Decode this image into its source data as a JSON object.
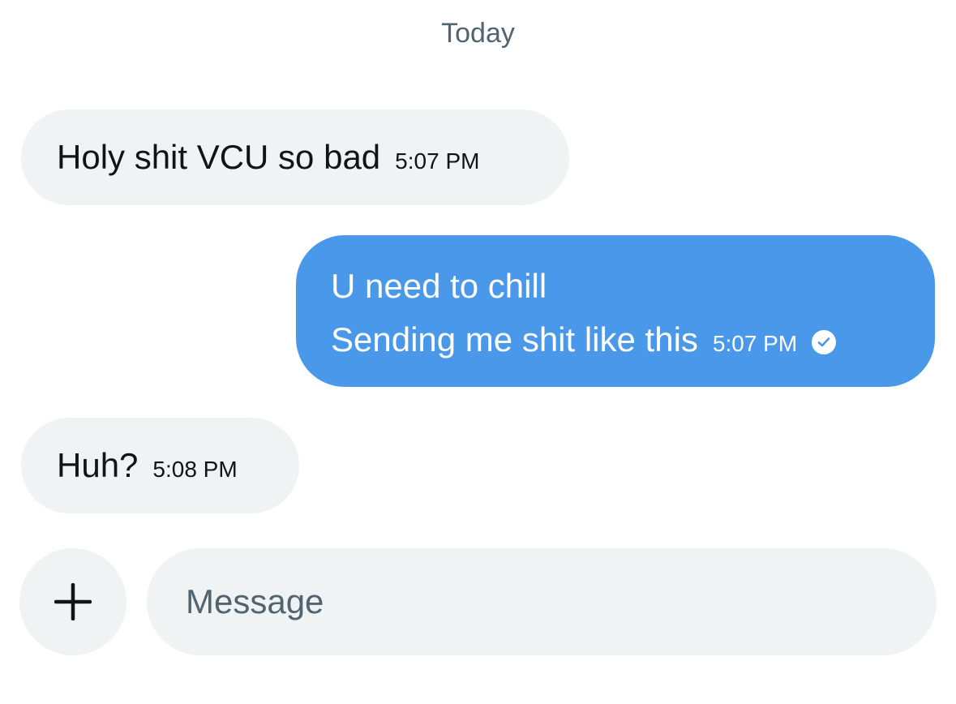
{
  "conversation": {
    "date_divider": "Today",
    "messages": [
      {
        "direction": "received",
        "lines": [
          "Holy shit VCU so bad"
        ],
        "time": "5:07 PM"
      },
      {
        "direction": "sent",
        "lines": [
          "U need to chill",
          "Sending me shit like this"
        ],
        "time": "5:07 PM",
        "status_icon": "read-check-icon"
      },
      {
        "direction": "received",
        "lines": [
          "Huh?"
        ],
        "time": "5:08 PM"
      }
    ]
  },
  "composer": {
    "add_icon": "plus-icon",
    "placeholder": "Message",
    "value": ""
  },
  "colors": {
    "received_bubble": "#eff3f4",
    "sent_bubble": "#4a98e9",
    "secondary_text": "#536471"
  }
}
